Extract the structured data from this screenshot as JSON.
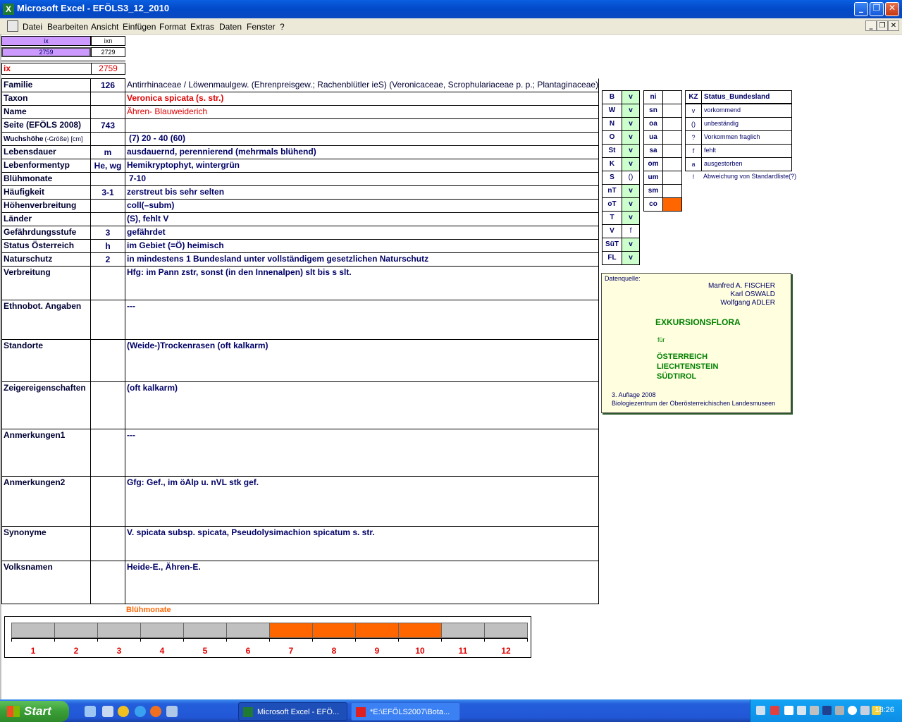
{
  "window": {
    "title": "Microsoft Excel - EFÖLS3_12_2010"
  },
  "menu": [
    "Datei",
    "Bearbeiten",
    "Ansicht",
    "Einfügen",
    "Format",
    "Extras",
    "Daten",
    "Fenster",
    "?"
  ],
  "index": {
    "hdr_ix": "ix",
    "hdr_ixn": "ixn",
    "val_ix": "2759",
    "val_ixn": "2729",
    "label": "ix",
    "value": "2759"
  },
  "rows": [
    {
      "label": "Familie",
      "num": "126",
      "text": "Antirrhinaceae  /  Löwenmaulgew. (Ehrenpreisgew.; Rachenblütler ieS) (Veronicaceae, Scrophulariaceae p. p.; Plantaginaceae)"
    },
    {
      "label": "Taxon",
      "num": "",
      "text": "Veronica spicata (s. str.)"
    },
    {
      "label": "Name",
      "num": "",
      "text": "Ähren- Blauweiderich"
    },
    {
      "label": "Seite (EFÖLS 2008)",
      "num": "743",
      "text": ""
    },
    {
      "label": "Wuchshöhe",
      "label_suffix": "(-Größe) [cm]",
      "num": "",
      "text": "(7) 20 - 40 (60)"
    },
    {
      "label": "Lebensdauer",
      "num": "m",
      "text": "ausdauernd, perennierend (mehrmals blühend)"
    },
    {
      "label": "Lebenformentyp",
      "num": "He, wg",
      "text": "Hemikryptophyt, wintergrün"
    },
    {
      "label": "Blühmonate",
      "num": "",
      "text": "7-10"
    },
    {
      "label": "Häufigkeit",
      "num": "3-1",
      "text": "zerstreut bis sehr selten"
    },
    {
      "label": "Höhenverbreitung",
      "num": "",
      "text": "coll(–subm)"
    },
    {
      "label": "Länder",
      "num": "",
      "text": "(S), fehlt V"
    },
    {
      "label": "Gefährdungsstufe",
      "num": "3",
      "text": "gefährdet"
    },
    {
      "label": "Status Österreich",
      "num": "h",
      "text": "im Gebiet (=Ö) heimisch"
    },
    {
      "label": "Naturschutz",
      "num": "2",
      "text": "in mindestens 1 Bundesland unter vollständigem gesetzlichen Naturschutz"
    },
    {
      "label": "Verbreitung",
      "num": "",
      "text": "Hfg: im Pann zstr, sonst (in den Innenalpen) slt bis s slt."
    },
    {
      "label": "Ethnobot. Angaben",
      "num": "",
      "text": "---"
    },
    {
      "label": "Standorte",
      "num": "",
      "text": "(Weide-)Trockenrasen (oft kalkarm)"
    },
    {
      "label": "Zeigereigenschaften",
      "num": "",
      "text": "(oft kalkarm)"
    },
    {
      "label": "Anmerkungen1",
      "num": "",
      "text": "---"
    },
    {
      "label": "Anmerkungen2",
      "num": "",
      "text": "Gfg: Gef., im öAlp u. nVL stk gef."
    },
    {
      "label": "Synonyme",
      "num": "",
      "text": "V. spicata subsp. spicata, Pseudolysimachion spicatum s. str."
    },
    {
      "label": "Volksnamen",
      "num": "",
      "text": "Heide-E., Ähren-E."
    }
  ],
  "states": [
    {
      "code": "B",
      "val": "v"
    },
    {
      "code": "W",
      "val": "v"
    },
    {
      "code": "N",
      "val": "v"
    },
    {
      "code": "O",
      "val": "v"
    },
    {
      "code": "St",
      "val": "v"
    },
    {
      "code": "K",
      "val": "v"
    },
    {
      "code": "S",
      "val": "()"
    },
    {
      "code": "nT",
      "val": "v"
    },
    {
      "code": "oT",
      "val": "v"
    },
    {
      "code": "T",
      "val": "v"
    },
    {
      "code": "V",
      "val": "f"
    },
    {
      "code": "SüT",
      "val": "v"
    },
    {
      "code": "FL",
      "val": "v"
    }
  ],
  "zones": [
    "ni",
    "sn",
    "oa",
    "ua",
    "sa",
    "om",
    "um",
    "sm",
    "co"
  ],
  "zone_highlight_color": "#ff6600",
  "legend": {
    "header_kz": "KZ",
    "header_title": "Status_Bundesland",
    "items": [
      {
        "kz": "v",
        "text": "vorkommend"
      },
      {
        "kz": "()",
        "text": "unbeständig"
      },
      {
        "kz": "?",
        "text": "Vorkommen fraglich"
      },
      {
        "kz": "f",
        "text": "fehlt"
      },
      {
        "kz": "a",
        "text": "ausgestorben"
      },
      {
        "kz": "!",
        "text": "Abweichung von Standardliste(?)"
      }
    ]
  },
  "source": {
    "label": "Datenquelle:",
    "authors": [
      "Manfred A. FISCHER",
      "Karl OSWALD",
      "Wolfgang ADLER"
    ],
    "title": "EXKURSIONSFLORA",
    "fuer": "für",
    "countries": [
      "ÖSTERREICH",
      "LIECHTENSTEIN",
      "SÜDTIROL"
    ],
    "edition": "3. Auflage 2008",
    "publisher": "Biologiezentrum der Oberösterreichischen Landesmuseen"
  },
  "chart_data": {
    "type": "bar",
    "title": "Blühmonate",
    "categories": [
      "1",
      "2",
      "3",
      "4",
      "5",
      "6",
      "7",
      "8",
      "9",
      "10",
      "11",
      "12"
    ],
    "values": [
      0,
      0,
      0,
      0,
      0,
      0,
      1,
      1,
      1,
      1,
      0,
      0
    ],
    "colors": {
      "active": "#ff6600",
      "inactive": "#c0c0c0"
    }
  },
  "taskbar": {
    "start": "Start",
    "tasks": [
      "Microsoft Excel - EFÖ...",
      "*E:\\EFÖLS2007\\Bota..."
    ],
    "clock": "18:26"
  }
}
